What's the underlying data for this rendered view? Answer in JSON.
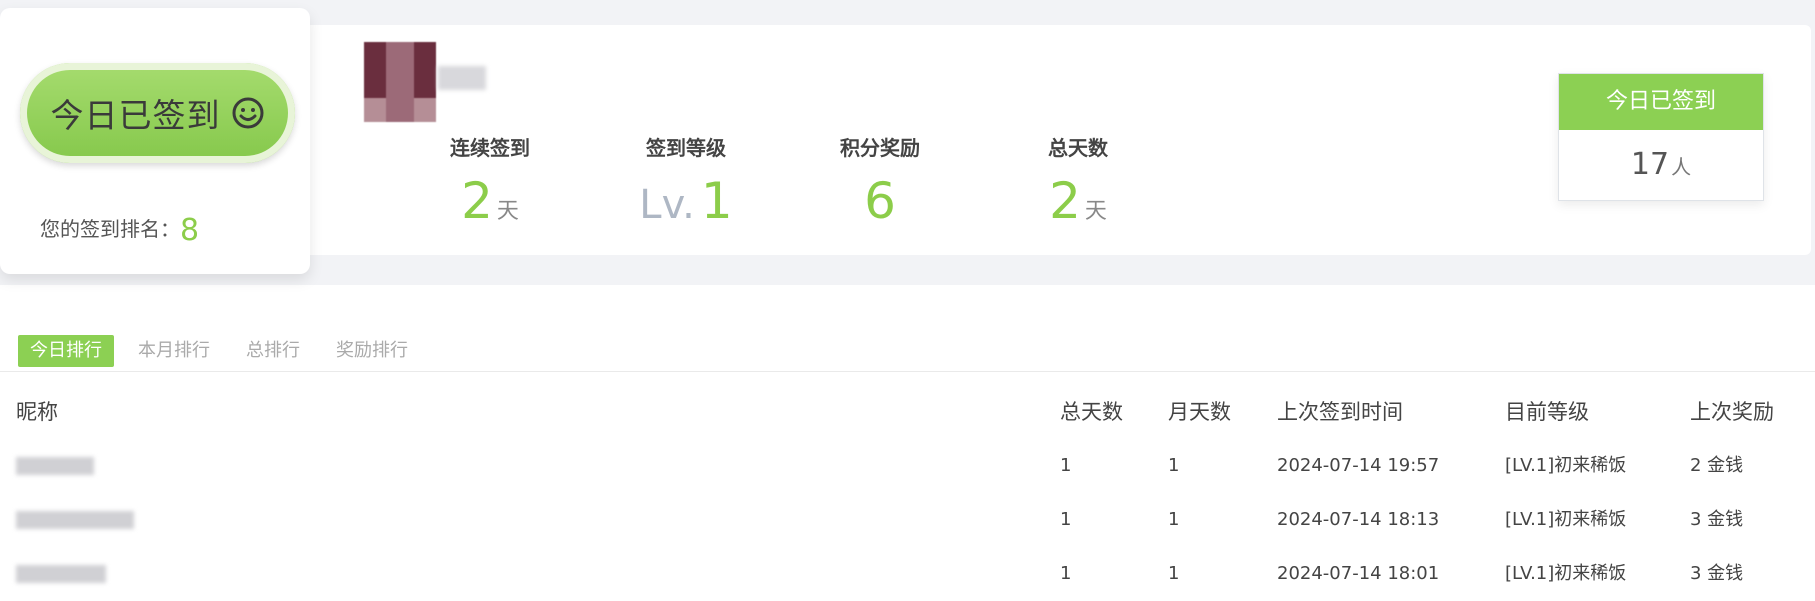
{
  "summary": {
    "signin_button_label": "今日已签到",
    "smile_icon": "smile-icon",
    "rank_label": "您的签到排名：",
    "rank_value": "8"
  },
  "stats": [
    {
      "label": "连续签到",
      "value": "2",
      "unit": "天"
    },
    {
      "label": "签到等级",
      "prefix": "Lv.",
      "value": "1"
    },
    {
      "label": "积分奖励",
      "value": "6"
    },
    {
      "label": "总天数",
      "value": "2",
      "unit": "天"
    }
  ],
  "today_box": {
    "title": "今日已签到",
    "count": "17",
    "unit": "人"
  },
  "tabs": [
    {
      "label": "今日排行",
      "active": true
    },
    {
      "label": "本月排行",
      "active": false
    },
    {
      "label": "总排行",
      "active": false
    },
    {
      "label": "奖励排行",
      "active": false
    }
  ],
  "table": {
    "headers": [
      "昵称",
      "总天数",
      "月天数",
      "上次签到时间",
      "目前等级",
      "上次奖励"
    ],
    "rows": [
      {
        "nickname": "",
        "total": "1",
        "month": "1",
        "last": "2024-07-14 19:57",
        "level": "[LV.1]初来稀饭",
        "reward": "2 金钱"
      },
      {
        "nickname": "",
        "total": "1",
        "month": "1",
        "last": "2024-07-14 18:13",
        "level": "[LV.1]初来稀饭",
        "reward": "3 金钱"
      },
      {
        "nickname": "",
        "total": "1",
        "month": "1",
        "last": "2024-07-14 18:01",
        "level": "[LV.1]初来稀饭",
        "reward": "3 金钱"
      }
    ]
  }
}
